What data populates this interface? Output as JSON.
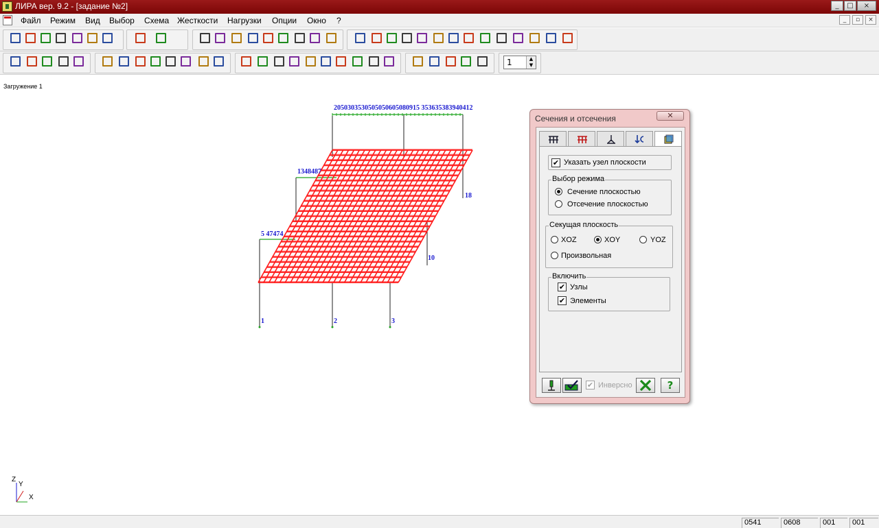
{
  "window": {
    "title": "ЛИРА  вер. 9.2 - [задание №2]",
    "controls": [
      "_",
      "□",
      "×"
    ],
    "mdi_controls": [
      "_",
      "▫",
      "×"
    ]
  },
  "menu": [
    {
      "label": "Файл",
      "underline": "Ф"
    },
    {
      "label": "Режим",
      "underline": "Р"
    },
    {
      "label": "Вид",
      "underline": "В"
    },
    {
      "label": "Выбор",
      "underline": "о"
    },
    {
      "label": "Схема",
      "underline": "С"
    },
    {
      "label": "Жесткости",
      "underline": "Ж"
    },
    {
      "label": "Нагрузки",
      "underline": "Н"
    },
    {
      "label": "Опции",
      "underline": "О"
    },
    {
      "label": "Окно",
      "underline": "к"
    },
    {
      "label": "?",
      "underline": "?"
    }
  ],
  "toolbar": {
    "spin_value": "1",
    "spin_up": "▲",
    "spin_down": "▼"
  },
  "colors": {
    "title_bg": "#8b0e0e",
    "model_red": "#ff1a1a",
    "model_green": "#1fa51f",
    "node_label": "#1a1ad0",
    "dialog_frame": "#f1c9c9"
  },
  "canvas": {
    "load_label": "Загружение  1",
    "node_labels": {
      "top_row": "2050303530505050605080915 353635383940412",
      "mid_row": "1348487",
      "left_row": "5  47474",
      "right_a": "18",
      "right_b": "10",
      "bottom": [
        "1",
        "2",
        "3"
      ]
    },
    "axes": {
      "z": "Z",
      "y": "Y",
      "x": "X"
    }
  },
  "dialog": {
    "title": "Сечения и отсечения",
    "close": "✕",
    "tabs": [
      "sections-tab",
      "cuts-tab",
      "node-tab",
      "rotate-tab",
      "view-tab"
    ],
    "active_tab": 4,
    "specify_node": {
      "label": "Указать узел плоскости",
      "checked": "✔"
    },
    "mode": {
      "title": "Выбор режима",
      "options": [
        "Сечение плоскостью",
        "Отсечение плоскостью"
      ],
      "selected": 0
    },
    "plane": {
      "title": "Секущая плоскость",
      "options": [
        "XOZ",
        "XOY",
        "YOZ",
        "Произвольная"
      ],
      "selected": 1
    },
    "include": {
      "title": "Включить",
      "items": [
        {
          "label": "Узлы",
          "checked": "✔"
        },
        {
          "label": "Элементы",
          "checked": "✔"
        }
      ]
    },
    "inverse": {
      "label": "Инверсно",
      "checked": "✔"
    },
    "help": "?"
  },
  "status": [
    "0541",
    "0608",
    "001",
    "001"
  ]
}
